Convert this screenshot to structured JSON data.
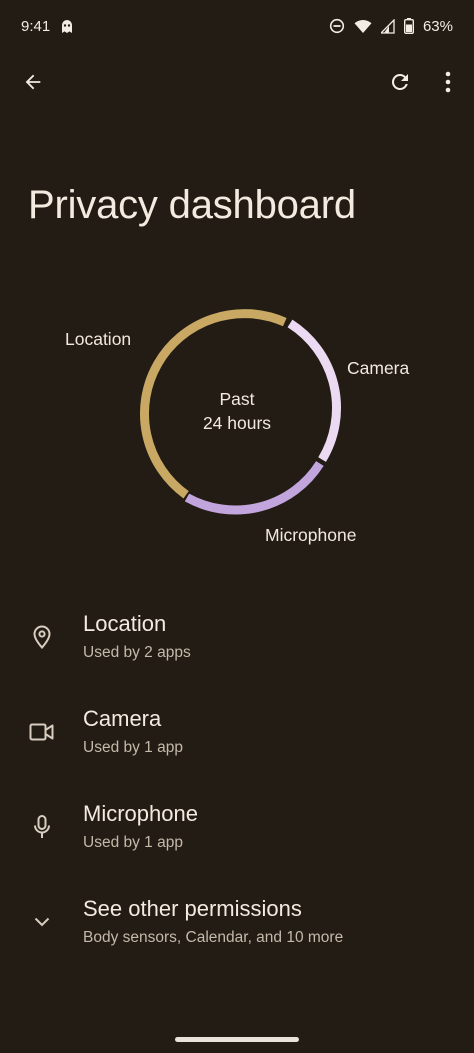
{
  "status_bar": {
    "time": "9:41",
    "battery": "63%",
    "icons": [
      "ghost-icon",
      "dnd-icon",
      "wifi-icon",
      "signal-icon",
      "battery-icon"
    ]
  },
  "toolbar": {
    "back_icon": "arrow-back-icon",
    "refresh_icon": "refresh-icon",
    "more_icon": "more-vert-icon"
  },
  "page": {
    "title": "Privacy dashboard"
  },
  "usage_ring": {
    "center_line1": "Past",
    "center_line2": "24 hours",
    "segments": [
      {
        "label": "Location",
        "color": "#c8a863"
      },
      {
        "label": "Camera",
        "color": "#ecdaf3"
      },
      {
        "label": "Microphone",
        "color": "#c3a5de"
      }
    ]
  },
  "permissions": [
    {
      "title": "Location",
      "subtitle": "Used by 2 apps",
      "icon": "location-pin-icon"
    },
    {
      "title": "Camera",
      "subtitle": "Used by 1 app",
      "icon": "videocam-icon"
    },
    {
      "title": "Microphone",
      "subtitle": "Used by 1 app",
      "icon": "mic-icon"
    },
    {
      "title": "See other permissions",
      "subtitle": "Body sensors, Calendar, and 10 more",
      "icon": "chevron-down-icon"
    }
  ],
  "colors": {
    "background": "#221c15",
    "text_primary": "#f3ebe0",
    "text_secondary": "#c5b9aa"
  }
}
